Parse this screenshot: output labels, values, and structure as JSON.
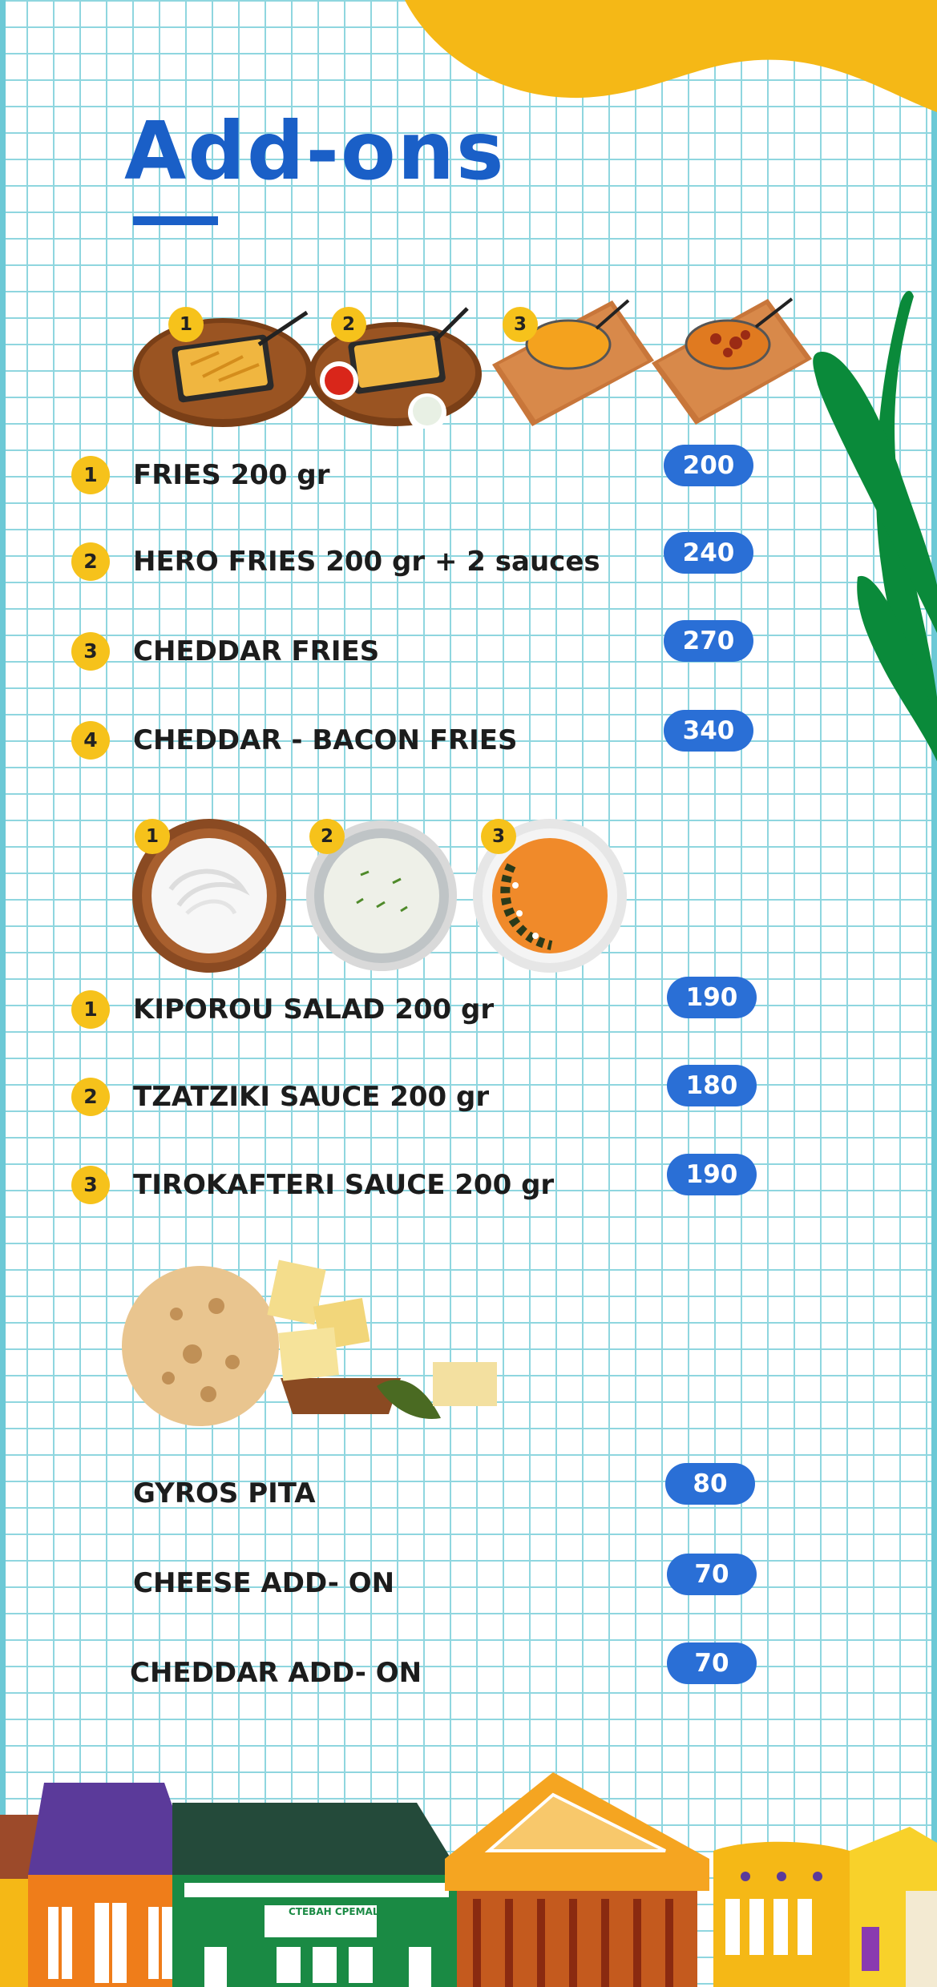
{
  "title": "Add-ons",
  "fries": {
    "photo_badges": [
      "1",
      "2",
      "3"
    ],
    "items": [
      {
        "num": "1",
        "label": "FRIES 200 gr",
        "price": "200"
      },
      {
        "num": "2",
        "label": "HERO FRIES 200 gr + 2 sauces",
        "price": "240"
      },
      {
        "num": "3",
        "label": "CHEDDAR FRIES",
        "price": "270"
      },
      {
        "num": "4",
        "label": "CHEDDAR - BACON FRIES",
        "price": "340"
      }
    ]
  },
  "sauces": {
    "photo_badges": [
      "1",
      "2",
      "3"
    ],
    "items": [
      {
        "num": "1",
        "label": "KIPOROU SALAD 200 gr",
        "price": "190"
      },
      {
        "num": "2",
        "label": "TZATZIKI SAUCE 200 gr",
        "price": "180"
      },
      {
        "num": "3",
        "label": "TIROKAFTERI SAUCE 200 gr",
        "price": "190"
      }
    ]
  },
  "extras": {
    "items": [
      {
        "label": "GYROS PITA",
        "price": "80"
      },
      {
        "label": "CHEESE ADD- ON",
        "price": "70"
      },
      {
        "label": "CHEDDAR ADD- ON",
        "price": "70"
      }
    ]
  },
  "storefront_sign": "СТЕВАН СРЕМАЦ",
  "colors": {
    "accent_blue": "#1a5fc7",
    "price_blue": "#2a6fd6",
    "badge_yellow": "#f6c21b",
    "grid": "#8fd6df",
    "blob": "#f5b816",
    "plant": "#0a8a3a"
  }
}
